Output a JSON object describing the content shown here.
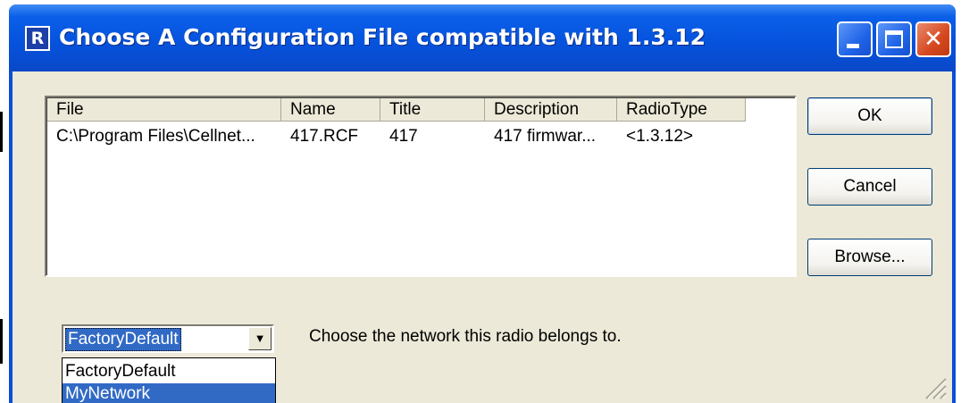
{
  "window": {
    "title": "Choose A Configuration File compatible with 1.3.12",
    "app_icon_glyph": "R",
    "controls": {
      "minimize": "minimize-icon",
      "maximize": "maximize-icon",
      "close": "close-icon",
      "close_glyph": "✕"
    }
  },
  "file_list": {
    "columns": [
      "File",
      "Name",
      "Title",
      "Description",
      "RadioType"
    ],
    "rows": [
      [
        "C:\\Program Files\\Cellnet...",
        "417.RCF",
        "417",
        "417 firmwar...",
        "<1.3.12>"
      ]
    ]
  },
  "buttons": {
    "ok": "OK",
    "cancel": "Cancel",
    "browse": "Browse..."
  },
  "network": {
    "selected": "FactoryDefault",
    "arrow_glyph": "▼",
    "options": [
      "FactoryDefault",
      "MyNetwork"
    ],
    "highlighted_option": "MyNetwork",
    "hint": "Choose the network this radio belongs to."
  },
  "colors": {
    "titlebar": "#0653de",
    "dialog_background": "#ece9d8",
    "selection": "#316ac5",
    "close_button": "#d6481f"
  }
}
